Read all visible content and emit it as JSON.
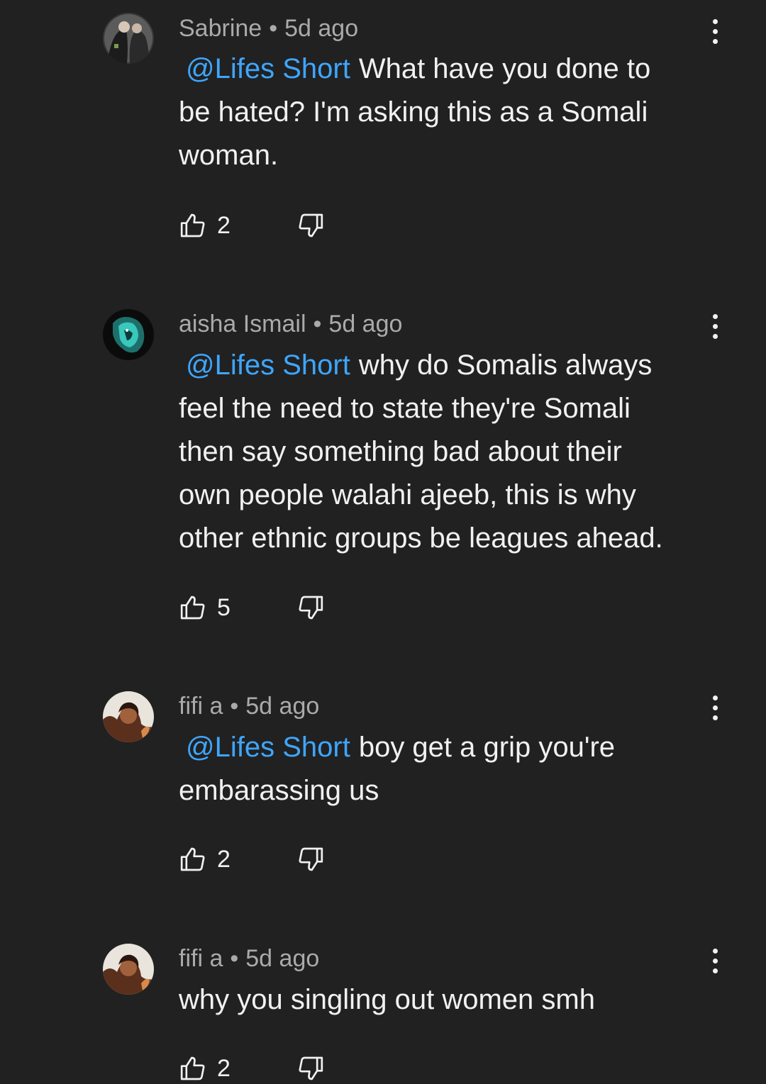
{
  "colors": {
    "background": "#212121",
    "mention": "#3ea6ff",
    "meta": "#aaaaaa",
    "text": "#f1f1f1"
  },
  "comments": [
    {
      "author": "Sabrine",
      "separator": "•",
      "time": "5d ago",
      "mention": "@Lifes Short",
      "lines": [
        "What have you done to",
        "be hated? I'm asking this as a Somali",
        "woman."
      ],
      "likes": "2",
      "avatar_icon": "avatar-sabrine"
    },
    {
      "author": "aisha Ismail",
      "separator": "•",
      "time": "5d ago",
      "mention": "@Lifes Short",
      "lines": [
        "why do Somalis always",
        "feel the need to state they're Somali",
        "then say something bad about their",
        "own people walahi ajeeb, this is why",
        "other ethnic groups be leagues ahead."
      ],
      "likes": "5",
      "avatar_icon": "avatar-lion"
    },
    {
      "author": "fifi a",
      "separator": "•",
      "time": "5d ago",
      "mention": "@Lifes Short",
      "lines": [
        "boy get a grip you're",
        "embarassing us"
      ],
      "likes": "2",
      "avatar_icon": "avatar-fifi"
    },
    {
      "author": "fifi a",
      "separator": "•",
      "time": "5d ago",
      "mention": "",
      "lines": [
        "why you singling out women smh"
      ],
      "likes": "2",
      "avatar_icon": "avatar-fifi"
    }
  ]
}
